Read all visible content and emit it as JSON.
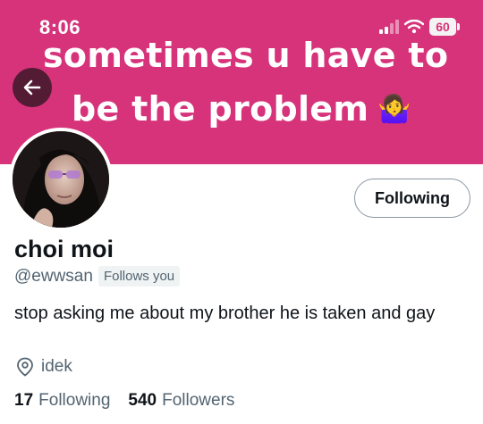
{
  "status_bar": {
    "time": "8:06",
    "battery": "60"
  },
  "banner": {
    "line1": "sometimes u have to",
    "line2": "be the problem",
    "emoji": "🤷‍♀️"
  },
  "profile": {
    "name": "choi moi",
    "handle": "@ewwsan",
    "follows_you": "Follows you",
    "bio": "stop asking me about my brother he is taken and gay",
    "location": "idek",
    "following_count": "17",
    "following_label": "Following",
    "followers_count": "540",
    "followers_label": "Followers"
  },
  "follow_button": {
    "label": "Following"
  },
  "icons": {
    "back": "arrow-left-icon",
    "location": "location-pin-icon"
  },
  "colors": {
    "banner": "#d6337a",
    "text_primary": "#0f1419",
    "text_secondary": "#536471"
  }
}
